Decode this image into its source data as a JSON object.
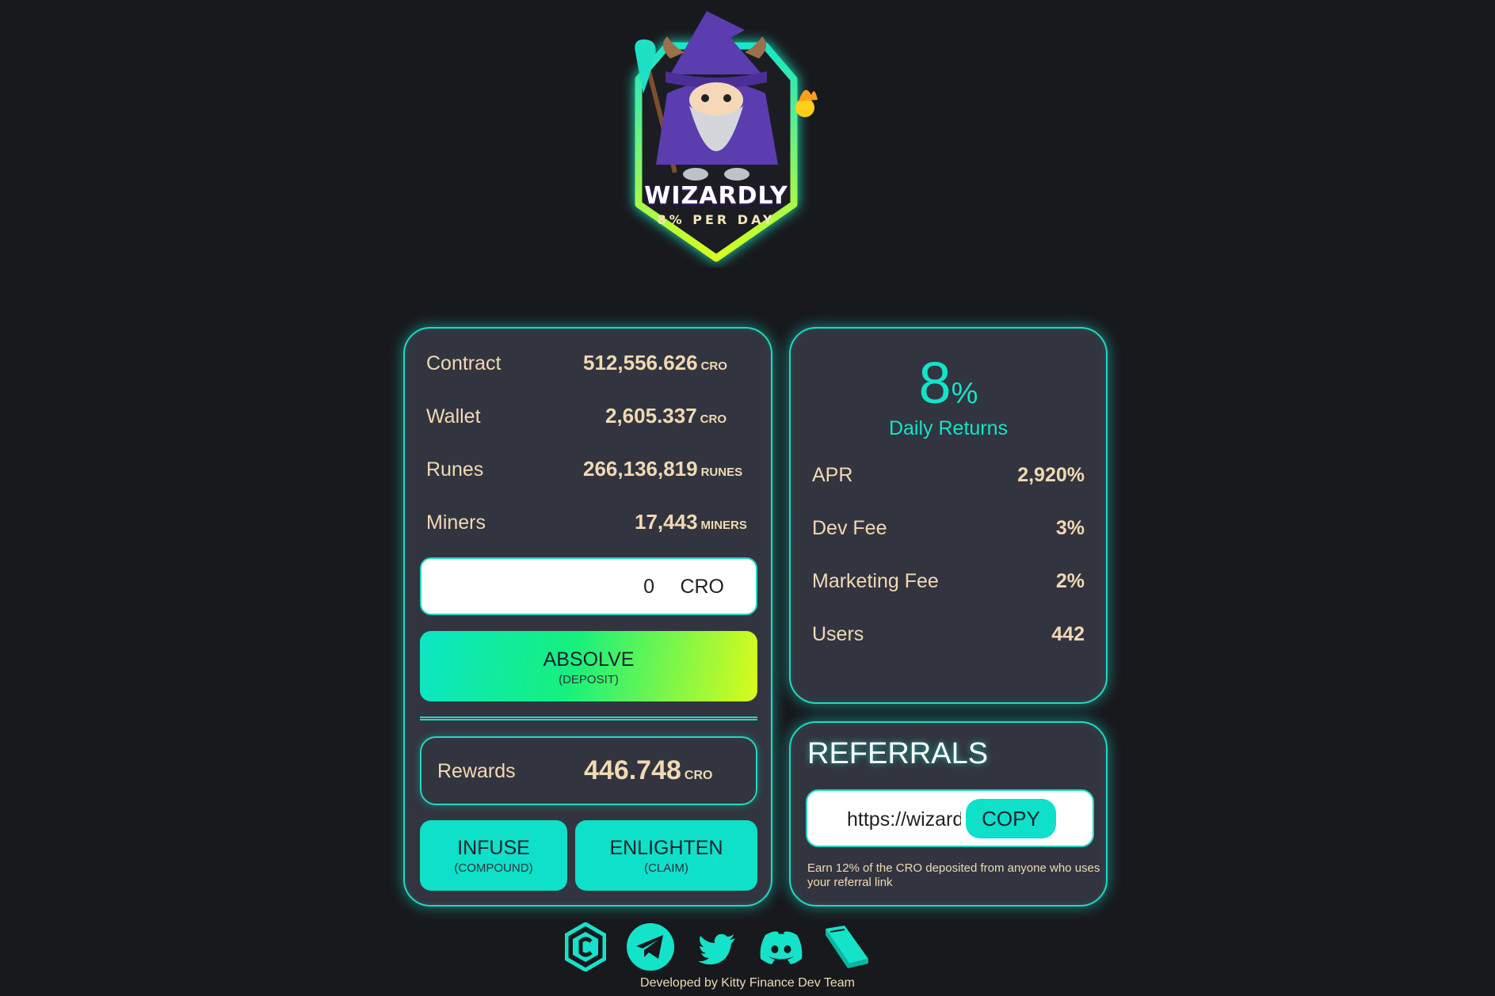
{
  "logo": {
    "title": "WIZARDLY",
    "subtitle": "8% PER DAY"
  },
  "stats": [
    {
      "label": "Contract",
      "value": "512,556.626",
      "unit": "CRO"
    },
    {
      "label": "Wallet",
      "value": "2,605.337",
      "unit": "CRO"
    },
    {
      "label": "Runes",
      "value": "266,136,819",
      "unit": "RUNES"
    },
    {
      "label": "Miners",
      "value": "17,443",
      "unit": "MINERS"
    }
  ],
  "deposit": {
    "amount_value": "0",
    "amount_unit": "CRO",
    "button_label": "ABSOLVE",
    "button_sublabel": "(DEPOSIT)"
  },
  "rewards": {
    "label": "Rewards",
    "value": "446.748",
    "unit": "CRO"
  },
  "actions": {
    "compound_label": "INFUSE",
    "compound_sublabel": "(COMPOUND)",
    "claim_label": "ENLIGHTEN",
    "claim_sublabel": "(CLAIM)"
  },
  "returns": {
    "rate_value": "8",
    "rate_unit": "%",
    "rate_label": "Daily Returns",
    "items": [
      {
        "label": "APR",
        "value": "2,920%"
      },
      {
        "label": "Dev Fee",
        "value": "3%"
      },
      {
        "label": "Marketing Fee",
        "value": "2%"
      },
      {
        "label": "Users",
        "value": "442"
      }
    ]
  },
  "referrals": {
    "title": "REFERRALS",
    "link_value": "https://wizardly",
    "copy_label": "COPY",
    "note": "Earn 12% of the CRO deposited from anyone who uses your referral link"
  },
  "social": [
    "cronos-icon",
    "telegram-icon",
    "twitter-icon",
    "discord-icon",
    "docs-book-icon"
  ],
  "footer": {
    "credit": "Developed by Kitty Finance Dev Team"
  },
  "colors": {
    "background": "#18191d",
    "panel": "#32353f",
    "accent": "#14e3c9",
    "text": "#f1d9b4"
  }
}
